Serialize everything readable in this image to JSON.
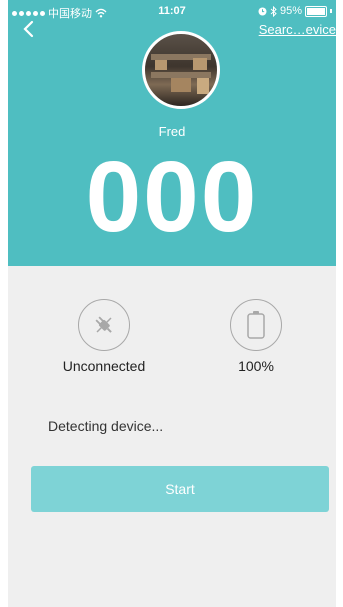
{
  "status_bar": {
    "carrier": "中国移动",
    "time": "11:07",
    "battery": "95%",
    "icons": [
      "signal-dots-icon",
      "wifi-icon",
      "alarm-icon",
      "bluetooth-icon",
      "battery-icon"
    ]
  },
  "header": {
    "back_icon": "chevron-left-icon",
    "search_label": "Searc…evice",
    "username": "Fred",
    "count": "000",
    "background_color": "#4fbec1"
  },
  "status": {
    "connection_label": "Unconnected",
    "connection_icon": "plug-icon",
    "battery_label": "100%",
    "battery_icon": "battery-icon"
  },
  "detecting_text": "Detecting device...",
  "start_button": {
    "label": "Start",
    "color": "#7ed3d6"
  }
}
